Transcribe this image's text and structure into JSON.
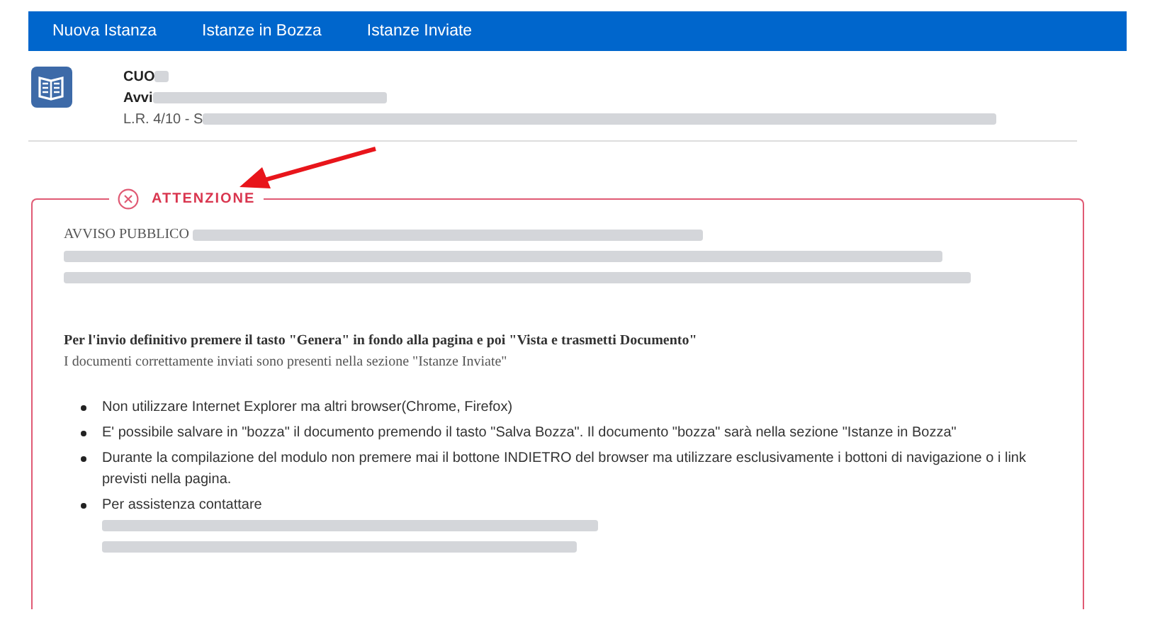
{
  "nav": [
    {
      "label": "Nuova Istanza"
    },
    {
      "label": "Istanze in Bozza"
    },
    {
      "label": "Istanze Inviate"
    }
  ],
  "header": {
    "code": "CUO",
    "title": "Avvi",
    "subtitle": "L.R. 4/10 - S"
  },
  "alert": {
    "title": "ATTENZIONE",
    "intro": "AVVISO PUBBLICO",
    "instruction": "Per l'invio definitivo premere il tasto \"Genera\" in fondo alla pagina e poi \"Vista e trasmetti Documento\"",
    "note": "I documenti correttamente inviati sono presenti nella sezione \"Istanze Inviate\"",
    "bullets": [
      "Non utilizzare Internet Explorer ma altri browser(Chrome, Firefox)",
      "E' possibile salvare in \"bozza\" il documento premendo il tasto \"Salva Bozza\". Il documento \"bozza\" sarà nella sezione \"Istanze in Bozza\"",
      "Durante la compilazione del modulo non premere mai il bottone INDIETRO del browser ma utilizzare esclusivamente i bottoni di navigazione o i link previsti nella pagina.",
      "Per assistenza contattare"
    ]
  }
}
